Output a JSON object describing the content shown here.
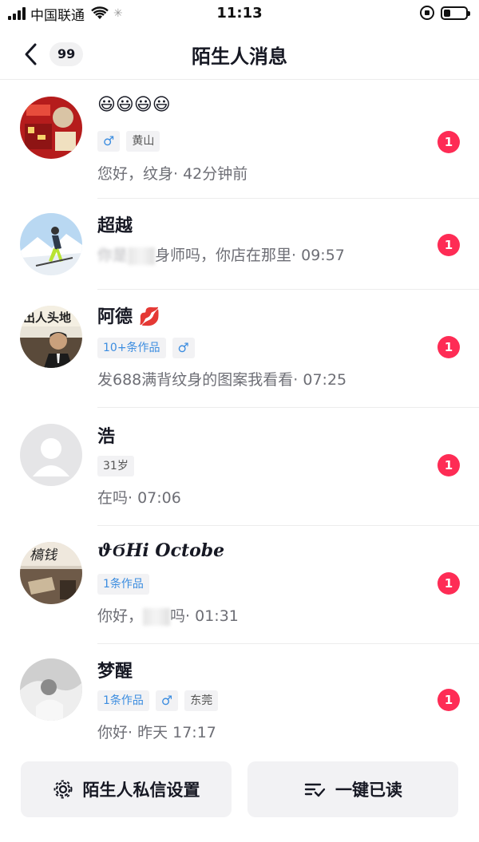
{
  "status_bar": {
    "carrier": "中国联通",
    "time": "11:13"
  },
  "header": {
    "title": "陌生人消息",
    "unread_count": "99"
  },
  "messages": [
    {
      "name": "😃😃😃😃",
      "tags": [
        {
          "text": "♂",
          "style": "male"
        },
        {
          "text": "黄山",
          "style": "gray"
        }
      ],
      "message": "您好，纹身",
      "time": "· 42分钟前",
      "unread": "1"
    },
    {
      "name": "超越",
      "tags": [],
      "message_part1": "你是",
      "message_part2": "身师吗，你店在那里",
      "time": "· 09:57",
      "unread": "1"
    },
    {
      "name": "阿德 💋",
      "tags": [
        {
          "text": "10+条作品",
          "style": "blue"
        },
        {
          "text": "♂",
          "style": "male"
        }
      ],
      "message": "发688满背纹身的图案我看看",
      "time": "· 07:25",
      "unread": "1"
    },
    {
      "name": "浩",
      "tags": [
        {
          "text": "31岁",
          "style": "gray"
        }
      ],
      "message": "在吗",
      "time": "· 07:06",
      "unread": "1"
    },
    {
      "name": "ϑϬHi Octobe",
      "tags": [
        {
          "text": "1条作品",
          "style": "blue"
        }
      ],
      "message_part1": "你好，",
      "message_part2": "吗",
      "time": "· 01:31",
      "unread": "1"
    },
    {
      "name": "梦醒",
      "tags": [
        {
          "text": "1条作品",
          "style": "blue"
        },
        {
          "text": "♂",
          "style": "male"
        },
        {
          "text": "东莞",
          "style": "gray"
        }
      ],
      "message": "你好",
      "time": "· 昨天 17:17",
      "unread": "1"
    }
  ],
  "bottom_actions": {
    "settings_label": "陌生人私信设置",
    "mark_read_label": "一键已读"
  },
  "colors": {
    "badge": "#fe2c55",
    "tag_blue": "#3c8de0",
    "text_primary": "#161823",
    "text_secondary": "#6d6e75"
  }
}
